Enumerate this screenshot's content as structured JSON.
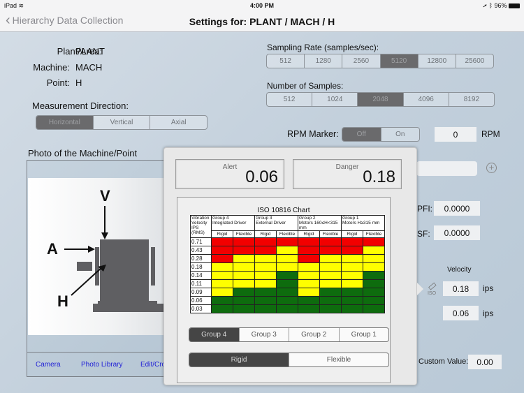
{
  "status_bar": {
    "device": "iPad",
    "time": "4:00 PM",
    "battery": "96%"
  },
  "nav": {
    "back_label": "Hierarchy Data Collection",
    "title": "Settings for: PLANT / MACH / H"
  },
  "info": {
    "plant_label": "Plant/Area:",
    "plant_value": "PLANT",
    "machine_label": "Machine:",
    "machine_value": "MACH",
    "point_label": "Point:",
    "point_value": "H"
  },
  "measurement_direction": {
    "label": "Measurement Direction:",
    "options": [
      "Horizontal",
      "Vertical",
      "Axial"
    ],
    "selected": "Horizontal"
  },
  "sampling_rate": {
    "label": "Sampling Rate (samples/sec):",
    "options": [
      "512",
      "1280",
      "2560",
      "5120",
      "12800",
      "25600"
    ],
    "selected": "5120"
  },
  "num_samples": {
    "label": "Number of Samples:",
    "options": [
      "512",
      "1024",
      "2048",
      "4096",
      "8192"
    ],
    "selected": "2048"
  },
  "rpm_marker": {
    "label": "RPM Marker:",
    "options": [
      "Off",
      "On"
    ],
    "selected": "Off",
    "value": "0",
    "unit": "RPM"
  },
  "photo": {
    "title": "Photo of the Machine/Point",
    "diagram_labels": {
      "v": "V",
      "a": "A",
      "h": "H"
    },
    "actions": [
      "Camera",
      "Photo Library",
      "Edit/Crop"
    ]
  },
  "right_panel": {
    "pfi_label": "PFI:",
    "pfi_value": "0.0000",
    "sf_label": "SF:",
    "sf_value": "0.0000",
    "velocity_label": "Velocity",
    "danger_value": "0.18",
    "alert_value": "0.06",
    "unit": "ips",
    "iso_icon_label": "ISO",
    "custom_label": "Custom Value:",
    "custom_value": "0.00"
  },
  "popover": {
    "alert_label": "Alert",
    "alert_value": "0.06",
    "danger_label": "Danger",
    "danger_value": "0.18",
    "group_options": [
      "Group 4",
      "Group 3",
      "Group 2",
      "Group 1"
    ],
    "group_selected": "Group 4",
    "foundation_options": [
      "Rigid",
      "Flexible"
    ],
    "foundation_selected": "Rigid"
  },
  "chart_data": {
    "type": "table",
    "title": "ISO 10816 Chart",
    "row_header": "Vibration Velocity IPS (RMS)",
    "groups": [
      {
        "name": "Group 4",
        "desc": "Integrated Driver"
      },
      {
        "name": "Group 3",
        "desc": "External Driver"
      },
      {
        "name": "Group 2",
        "desc": "Motors 160≤H<315 mm"
      },
      {
        "name": "Group 1",
        "desc": "Motors H≥315 mm"
      }
    ],
    "subcolumns": [
      "Rigid",
      "Flexible"
    ],
    "rows": [
      "0.71",
      "0.43",
      "0.28",
      "0.18",
      "0.14",
      "0.11",
      "0.09",
      "0.06",
      "0.03"
    ],
    "legend": {
      "R": "#f20000",
      "Y": "#ffff00",
      "G": "#0e6c0e"
    },
    "cells": [
      [
        "R",
        "R",
        "R",
        "R",
        "R",
        "R",
        "R",
        "R"
      ],
      [
        "R",
        "R",
        "R",
        "Y",
        "R",
        "R",
        "R",
        "Y"
      ],
      [
        "R",
        "Y",
        "Y",
        "Y",
        "R",
        "Y",
        "Y",
        "Y"
      ],
      [
        "Y",
        "Y",
        "Y",
        "Y",
        "Y",
        "Y",
        "Y",
        "Y"
      ],
      [
        "Y",
        "Y",
        "Y",
        "G",
        "Y",
        "Y",
        "Y",
        "G"
      ],
      [
        "Y",
        "Y",
        "Y",
        "G",
        "Y",
        "Y",
        "Y",
        "G"
      ],
      [
        "Y",
        "G",
        "G",
        "G",
        "Y",
        "G",
        "G",
        "G"
      ],
      [
        "G",
        "G",
        "G",
        "G",
        "G",
        "G",
        "G",
        "G"
      ],
      [
        "G",
        "G",
        "G",
        "G",
        "G",
        "G",
        "G",
        "G"
      ]
    ]
  }
}
